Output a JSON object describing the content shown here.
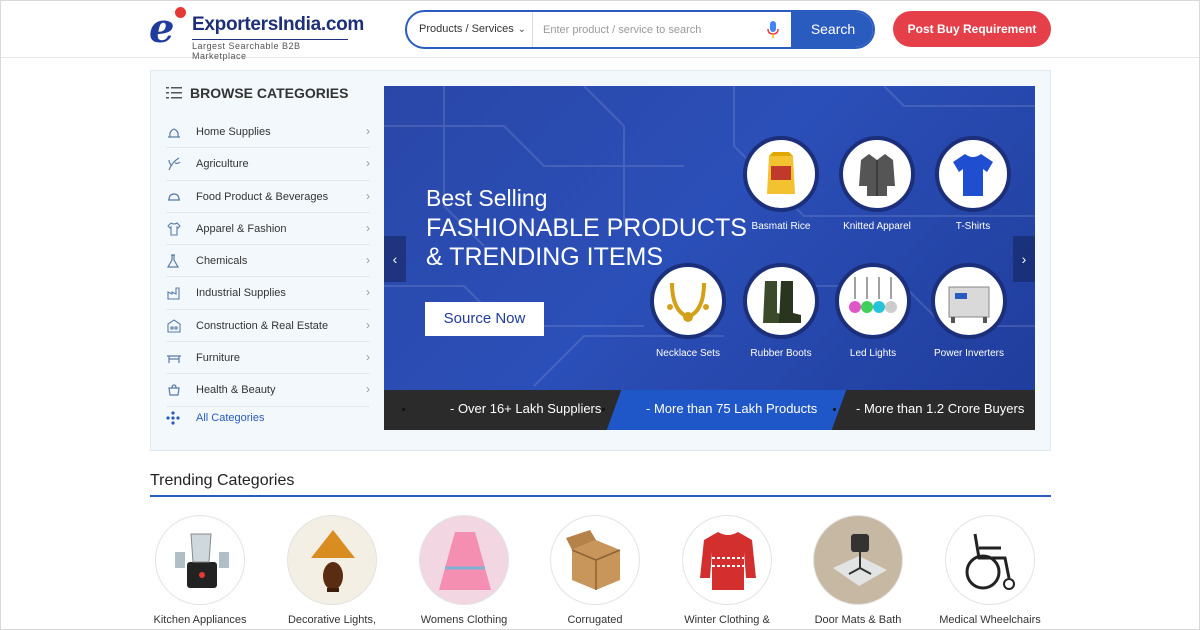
{
  "header": {
    "logo_text": "ExportersIndia.com",
    "logo_tagline": "Largest Searchable B2B Marketplace",
    "search_category": "Products / Services",
    "search_placeholder": "Enter product / service to search",
    "search_button": "Search",
    "post_button": "Post Buy Requirement"
  },
  "sidebar": {
    "title": "BROWSE CATEGORIES",
    "items": [
      {
        "label": "Home Supplies",
        "icon": "home-supplies-icon"
      },
      {
        "label": "Agriculture",
        "icon": "agriculture-icon"
      },
      {
        "label": "Food Product & Beverages",
        "icon": "food-icon"
      },
      {
        "label": "Apparel & Fashion",
        "icon": "apparel-icon"
      },
      {
        "label": "Chemicals",
        "icon": "chemicals-icon"
      },
      {
        "label": "Industrial Supplies",
        "icon": "industrial-icon"
      },
      {
        "label": "Construction & Real Estate",
        "icon": "construction-icon"
      },
      {
        "label": "Furniture",
        "icon": "furniture-icon"
      },
      {
        "label": "Health & Beauty",
        "icon": "health-icon"
      }
    ],
    "all_categories": "All Categories"
  },
  "banner": {
    "title_line1": "Best Selling",
    "title_line2": "FASHIONABLE PRODUCTS",
    "title_line3": "& TRENDING ITEMS",
    "cta": "Source Now",
    "products": [
      {
        "label": "Basmati Rice"
      },
      {
        "label": "Knitted Apparel"
      },
      {
        "label": "T-Shirts"
      },
      {
        "label": "Necklace Sets"
      },
      {
        "label": "Rubber Boots"
      },
      {
        "label": "Led Lights"
      },
      {
        "label": "Power Inverters"
      }
    ],
    "stats": [
      "- Over 16+ Lakh Suppliers",
      "- More than 75 Lakh Products",
      "- More than 1.2 Crore Buyers"
    ]
  },
  "trending": {
    "title": "Trending Categories",
    "items": [
      {
        "label": "Kitchen Appliances"
      },
      {
        "label": "Decorative Lights,"
      },
      {
        "label": "Womens Clothing"
      },
      {
        "label": "Corrugated"
      },
      {
        "label": "Winter Clothing &"
      },
      {
        "label": "Door Mats & Bath"
      },
      {
        "label": "Medical Wheelchairs"
      }
    ]
  },
  "colors": {
    "brand_blue": "#2a5bbf",
    "post_red": "#e5404a",
    "banner_blue": "#2b4fb8"
  }
}
